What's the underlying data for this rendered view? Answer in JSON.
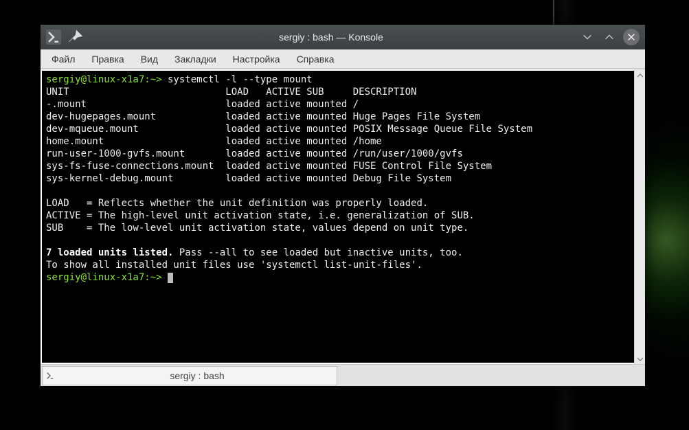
{
  "window": {
    "title": "sergiy : bash — Konsole"
  },
  "menubar": {
    "file": "Файл",
    "edit": "Правка",
    "view": "Вид",
    "bookmarks": "Закладки",
    "settings": "Настройка",
    "help": "Справка"
  },
  "terminal": {
    "prompt1": "sergiy@linux-x1a7:~>",
    "command": " systemctl -l --type mount",
    "header": "UNIT                           LOAD   ACTIVE SUB     DESCRIPTION",
    "rows": [
      "-.mount                        loaded active mounted /",
      "dev-hugepages.mount            loaded active mounted Huge Pages File System",
      "dev-mqueue.mount               loaded active mounted POSIX Message Queue File System",
      "home.mount                     loaded active mounted /home",
      "run-user-1000-gvfs.mount       loaded active mounted /run/user/1000/gvfs",
      "sys-fs-fuse-connections.mount  loaded active mounted FUSE Control File System",
      "sys-kernel-debug.mount         loaded active mounted Debug File System"
    ],
    "legend_load": "LOAD   = Reflects whether the unit definition was properly loaded.",
    "legend_active": "ACTIVE = The high-level unit activation state, i.e. generalization of SUB.",
    "legend_sub": "SUB    = The low-level unit activation state, values depend on unit type.",
    "summary_bold": "7 loaded units listed.",
    "summary_rest": " Pass --all to see loaded but inactive units, too.",
    "hint": "To show all installed unit files use 'systemctl list-unit-files'.",
    "prompt2": "sergiy@linux-x1a7:~> "
  },
  "tab": {
    "label": "sergiy : bash"
  }
}
